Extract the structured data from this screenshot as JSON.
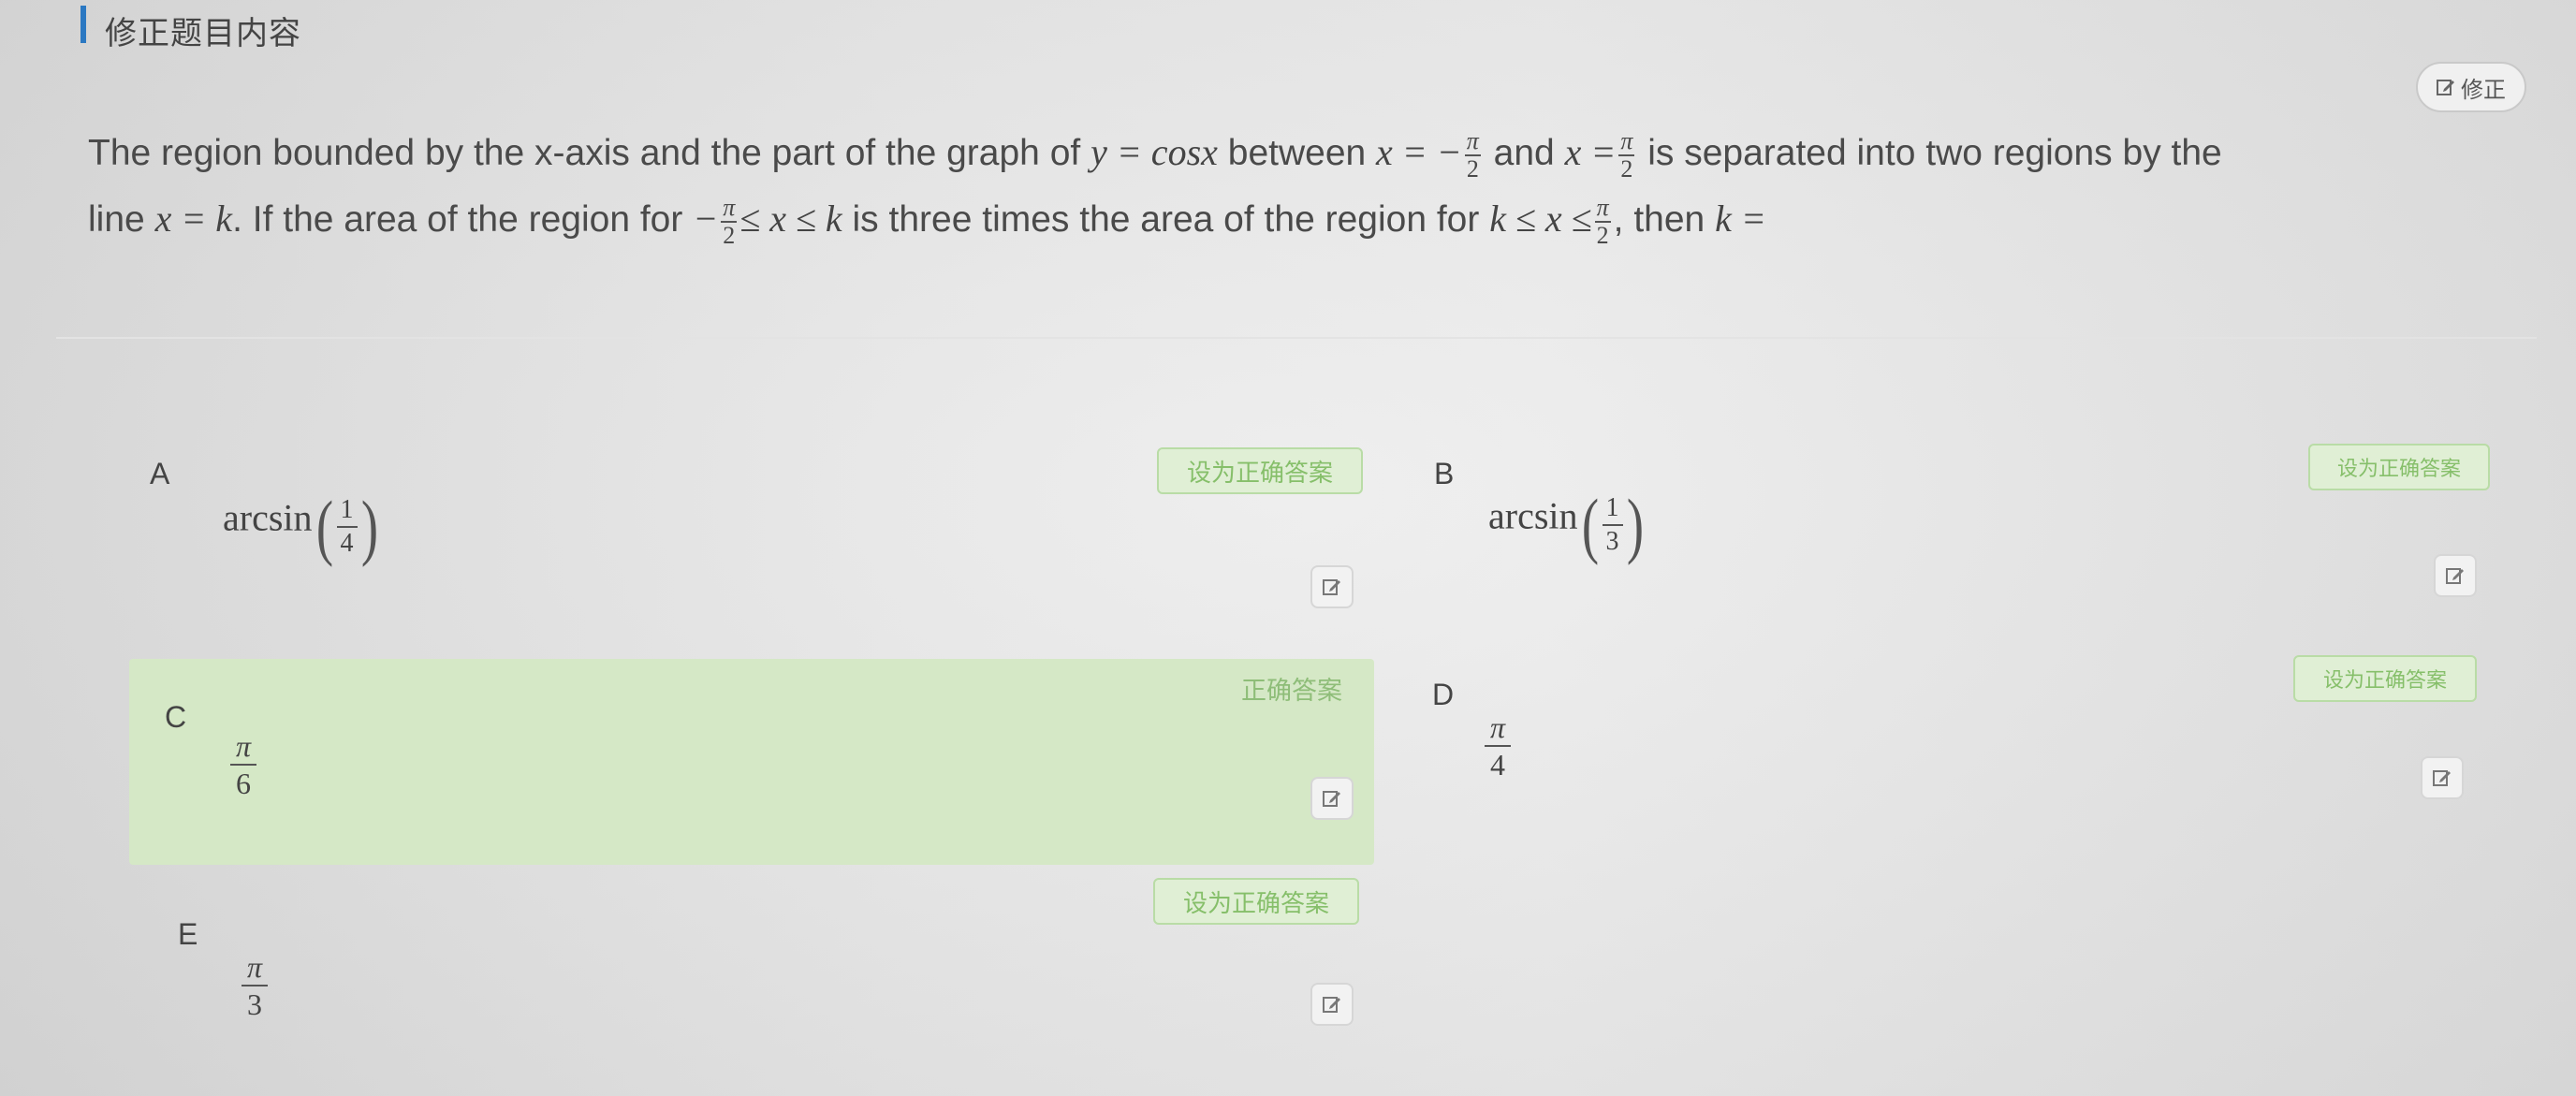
{
  "header": {
    "title": "修正题目内容",
    "fix_button_label": "修正"
  },
  "question": {
    "parts": {
      "p1": "The region bounded by the x-axis and the part of the graph of",
      "eq1": "y = cos",
      "eq1_var": "x",
      "p2": "between",
      "x_eq": "x = −",
      "pi": "π",
      "two": "2",
      "p3": "and",
      "x_eq2": "x =",
      "p4": "is separated into two regions by the",
      "p5": "line",
      "line_eq": "x = k",
      "p6": ". If the area of the region for",
      "neg": "−",
      "ineq1": "≤ x ≤ k",
      "p7": "is three times the area of the region for",
      "ineq2": "k ≤ x ≤",
      "p8": ", then",
      "ans": "k ="
    }
  },
  "options": [
    {
      "letter": "A",
      "value_func": "arcsin",
      "num": "1",
      "den": "4",
      "action": "设为正确答案"
    },
    {
      "letter": "B",
      "value_func": "arcsin",
      "num": "1",
      "den": "3",
      "action": "设为正确答案"
    },
    {
      "letter": "C",
      "num": "π",
      "den": "6",
      "status": "正确答案"
    },
    {
      "letter": "D",
      "num": "π",
      "den": "4",
      "action": "设为正确答案"
    },
    {
      "letter": "E",
      "num": "π",
      "den": "3",
      "action": "设为正确答案"
    }
  ],
  "colors": {
    "accent_bar": "#2b78c2",
    "correct_bg": "#d5e8c6",
    "correct_text": "#86bf6a"
  },
  "icons": {
    "edit": "edit-icon"
  }
}
